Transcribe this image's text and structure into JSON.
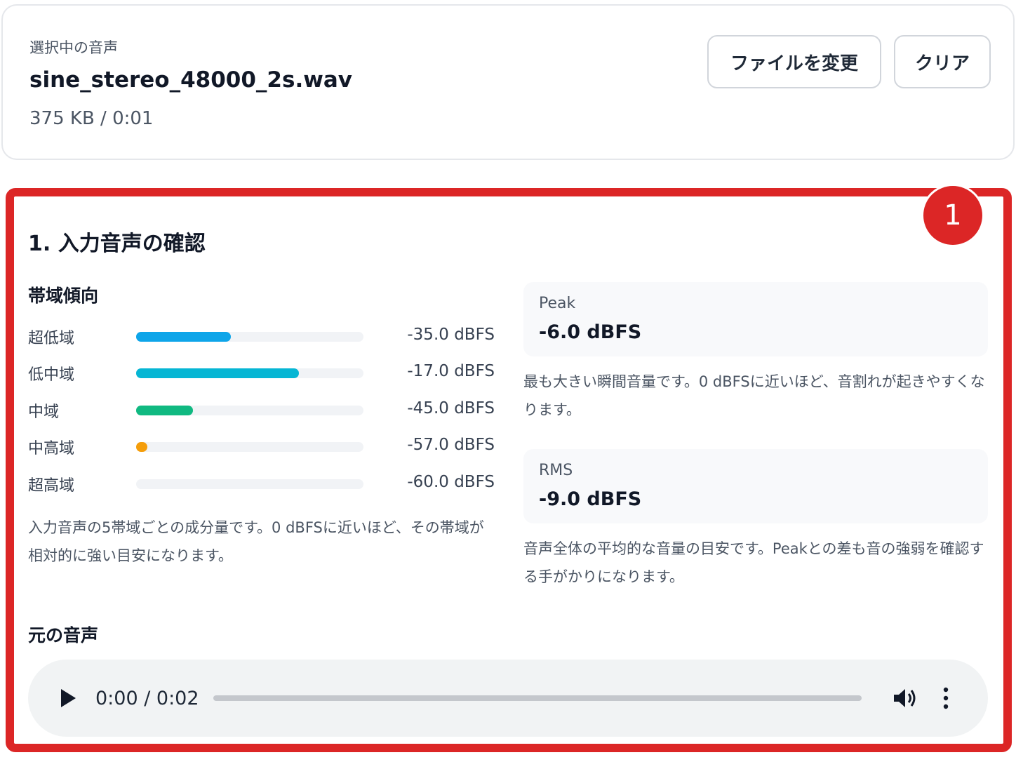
{
  "file": {
    "label": "選択中の音声",
    "name": "sine_stereo_48000_2s.wav",
    "meta": "375 KB / 0:01",
    "change_button": "ファイルを変更",
    "clear_button": "クリア"
  },
  "badge": "1",
  "section": {
    "title": "1. 入力音声の確認",
    "band_title": "帯域傾向",
    "bands": [
      {
        "label": "超低域",
        "value": "-35.0 dBFS",
        "level": 0.417,
        "color": "#0ea5e9"
      },
      {
        "label": "低中域",
        "value": "-17.0 dBFS",
        "level": 0.717,
        "color": "#06b6d4"
      },
      {
        "label": "中域",
        "value": "-45.0 dBFS",
        "level": 0.25,
        "color": "#10b981"
      },
      {
        "label": "中高域",
        "value": "-57.0 dBFS",
        "level": 0.05,
        "color": "#f59e0b"
      },
      {
        "label": "超高域",
        "value": "-60.0 dBFS",
        "level": 0,
        "color": "#9ca3af"
      }
    ],
    "band_note": "入力音声の5帯域ごとの成分量です。0 dBFSに近いほど、その帯域が相対的に強い目安になります。",
    "peak": {
      "label": "Peak",
      "value": "-6.0 dBFS",
      "note": "最も大きい瞬間音量です。0 dBFSに近いほど、音割れが起きやすくなります。"
    },
    "rms": {
      "label": "RMS",
      "value": "-9.0 dBFS",
      "note": "音声全体の平均的な音量の目安です。Peakとの差も音の強弱を確認する手がかりになります。"
    }
  },
  "original": {
    "title": "元の音声",
    "time": "0:00 / 0:02",
    "progress": 0
  }
}
